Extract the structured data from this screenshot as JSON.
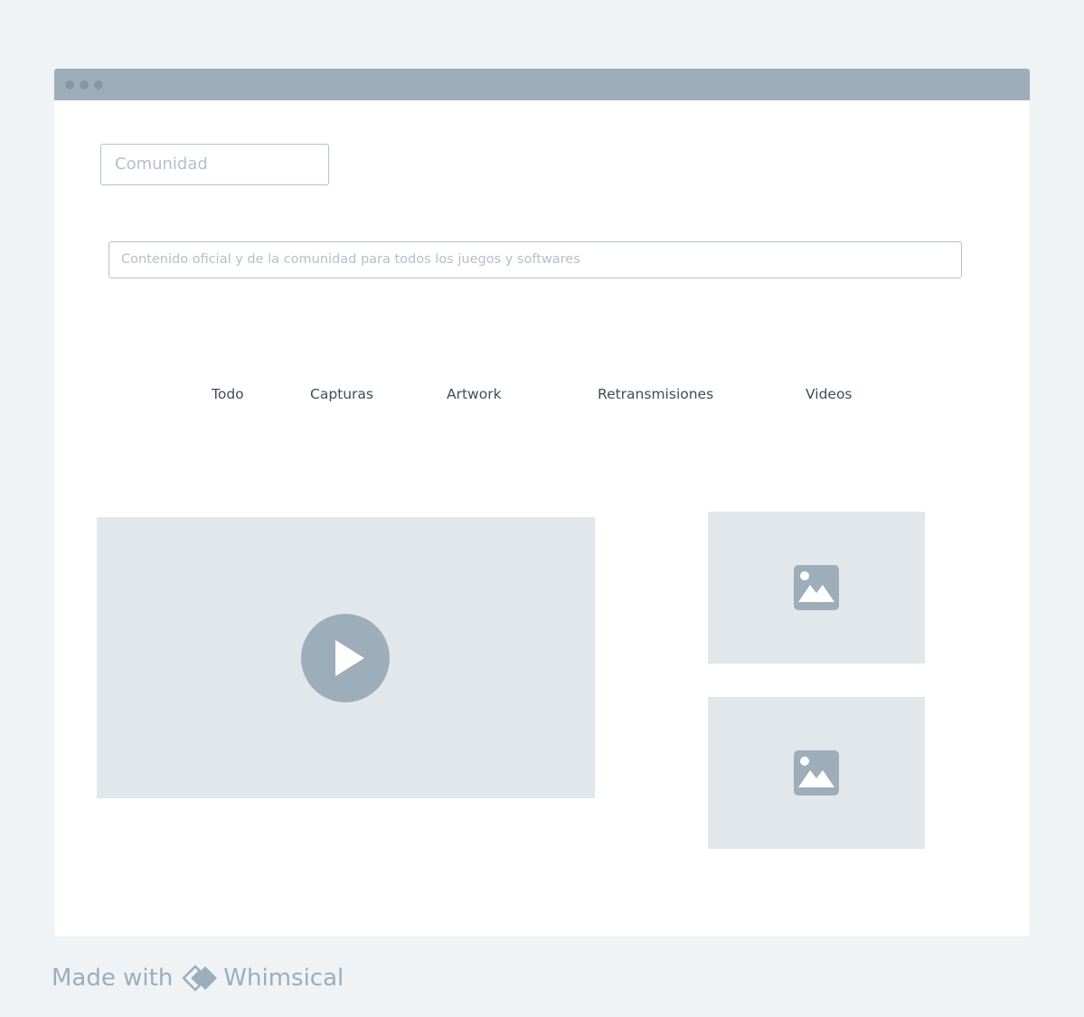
{
  "colors": {
    "page_background": "#eff3f6",
    "window_background": "#ffffff",
    "title_bar": "#9eadba",
    "window_dots": "#8696a4",
    "placeholder_text": "#b4bfca",
    "input_border": "#b5c0ca",
    "tab_text": "#3f4d5a",
    "media_placeholder": "#e2e7eb",
    "media_icon": "#9eadba"
  },
  "search": {
    "placeholder": "Comunidad"
  },
  "description": {
    "placeholder": "Contenido oficial y de la comunidad para todos los juegos y softwares"
  },
  "tabs": [
    {
      "label": "Todo"
    },
    {
      "label": "Capturas"
    },
    {
      "label": "Artwork"
    },
    {
      "label": "Retransmisiones"
    },
    {
      "label": "Videos"
    }
  ],
  "media": {
    "video_icon": "play-icon",
    "image_icon": "image-icon"
  },
  "footer": {
    "made_with": "Made with",
    "brand": "Whimsical",
    "brand_icon": "whimsical-logo-icon"
  }
}
